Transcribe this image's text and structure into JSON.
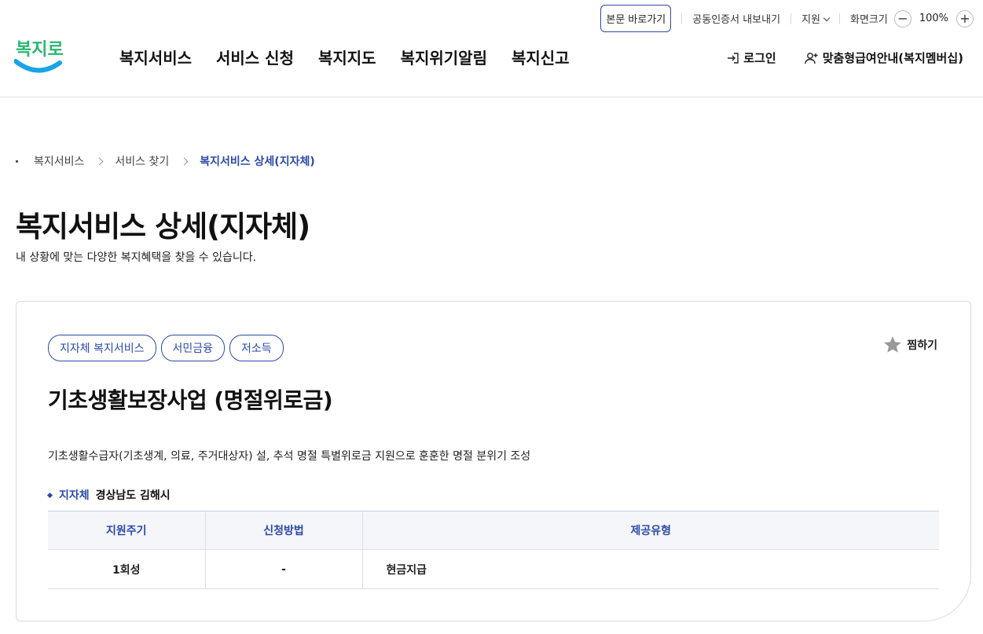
{
  "util": {
    "skip": "본문 바로가기",
    "cert": "공동인증서 내보내기",
    "support": "지원",
    "zoom_label": "화면크기",
    "zoom_minus": "−",
    "zoom_value": "100%",
    "zoom_plus": "+"
  },
  "logo": {
    "text": "복지로"
  },
  "gnb": [
    "복지서비스",
    "서비스 신청",
    "복지지도",
    "복지위기알림",
    "복지신고"
  ],
  "member": {
    "login": "로그인",
    "join": "맞춤형급여안내(복지멤버십)"
  },
  "breadcrumb": [
    "복지서비스",
    "서비스 찾기",
    "복지서비스 상세(지자체)"
  ],
  "page": {
    "title": "복지서비스 상세(지자체)",
    "desc": "내 상황에 맞는 다양한 복지혜택을 찾을 수 있습니다."
  },
  "service": {
    "tags": [
      "지자체 복지서비스",
      "서민금융",
      "저소득"
    ],
    "favorite": "찜하기",
    "title": "기초생활보장사업 (명절위로금)",
    "desc": "기초생활수급자(기초생계, 의료, 주거대상자) 설, 추석 명절 특별위로금 지원으로 훈훈한 명절 분위기 조성",
    "region_label": "지자체",
    "region_value": "경상남도 김해시",
    "table": {
      "headers": [
        "지원주기",
        "신청방법",
        "제공유형"
      ],
      "row": [
        "1회성",
        "-",
        "현금지급"
      ]
    }
  },
  "colors": {
    "accent": "#2b4aa8",
    "logo_blue": "#1aa3e8",
    "logo_green": "#2bb673"
  }
}
